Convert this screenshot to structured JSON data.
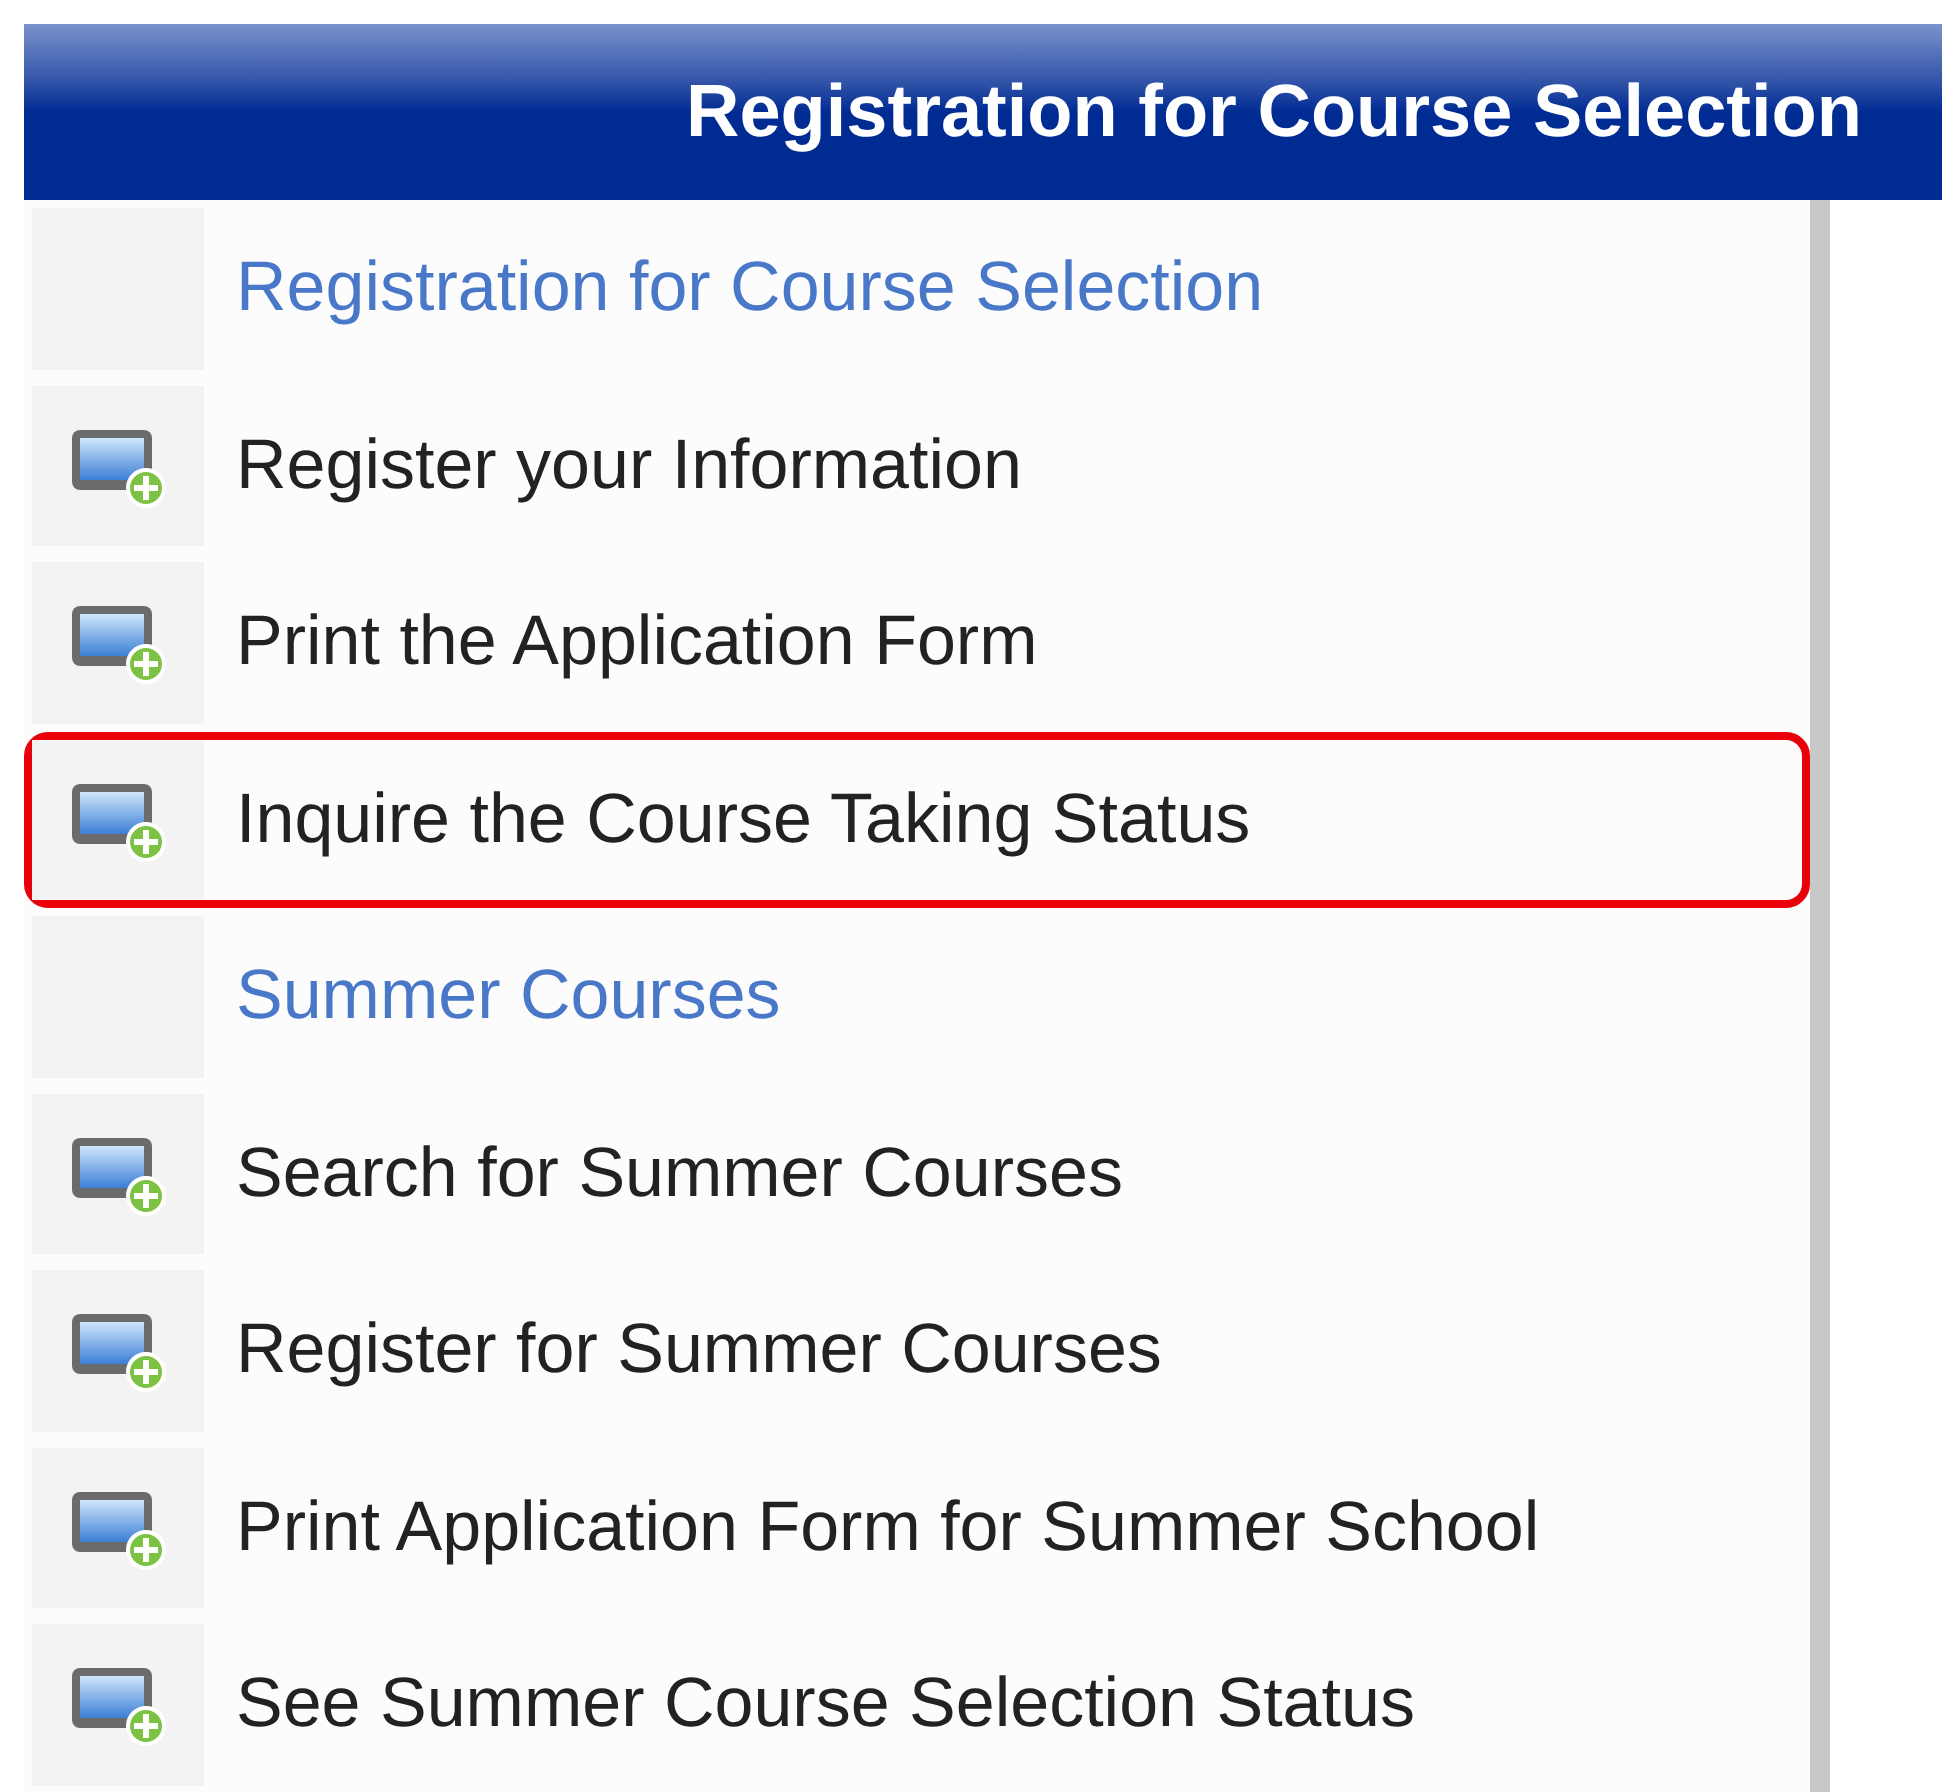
{
  "header": {
    "title": "Registration for Course Selection"
  },
  "menu": {
    "items": [
      {
        "kind": "heading",
        "label": "Registration for Course Selection",
        "highlighted": false
      },
      {
        "kind": "item",
        "label": "Register your Information",
        "highlighted": false
      },
      {
        "kind": "item",
        "label": "Print the Application Form",
        "highlighted": false
      },
      {
        "kind": "item",
        "label": "Inquire the Course Taking Status",
        "highlighted": true
      },
      {
        "kind": "heading",
        "label": "Summer Courses",
        "highlighted": false
      },
      {
        "kind": "item",
        "label": "Search for Summer Courses",
        "highlighted": false
      },
      {
        "kind": "item",
        "label": "Register for Summer Courses",
        "highlighted": false
      },
      {
        "kind": "item",
        "label": "Print Application Form for Summer School",
        "highlighted": false
      },
      {
        "kind": "item",
        "label": "See Summer Course Selection Status",
        "highlighted": false
      }
    ]
  }
}
